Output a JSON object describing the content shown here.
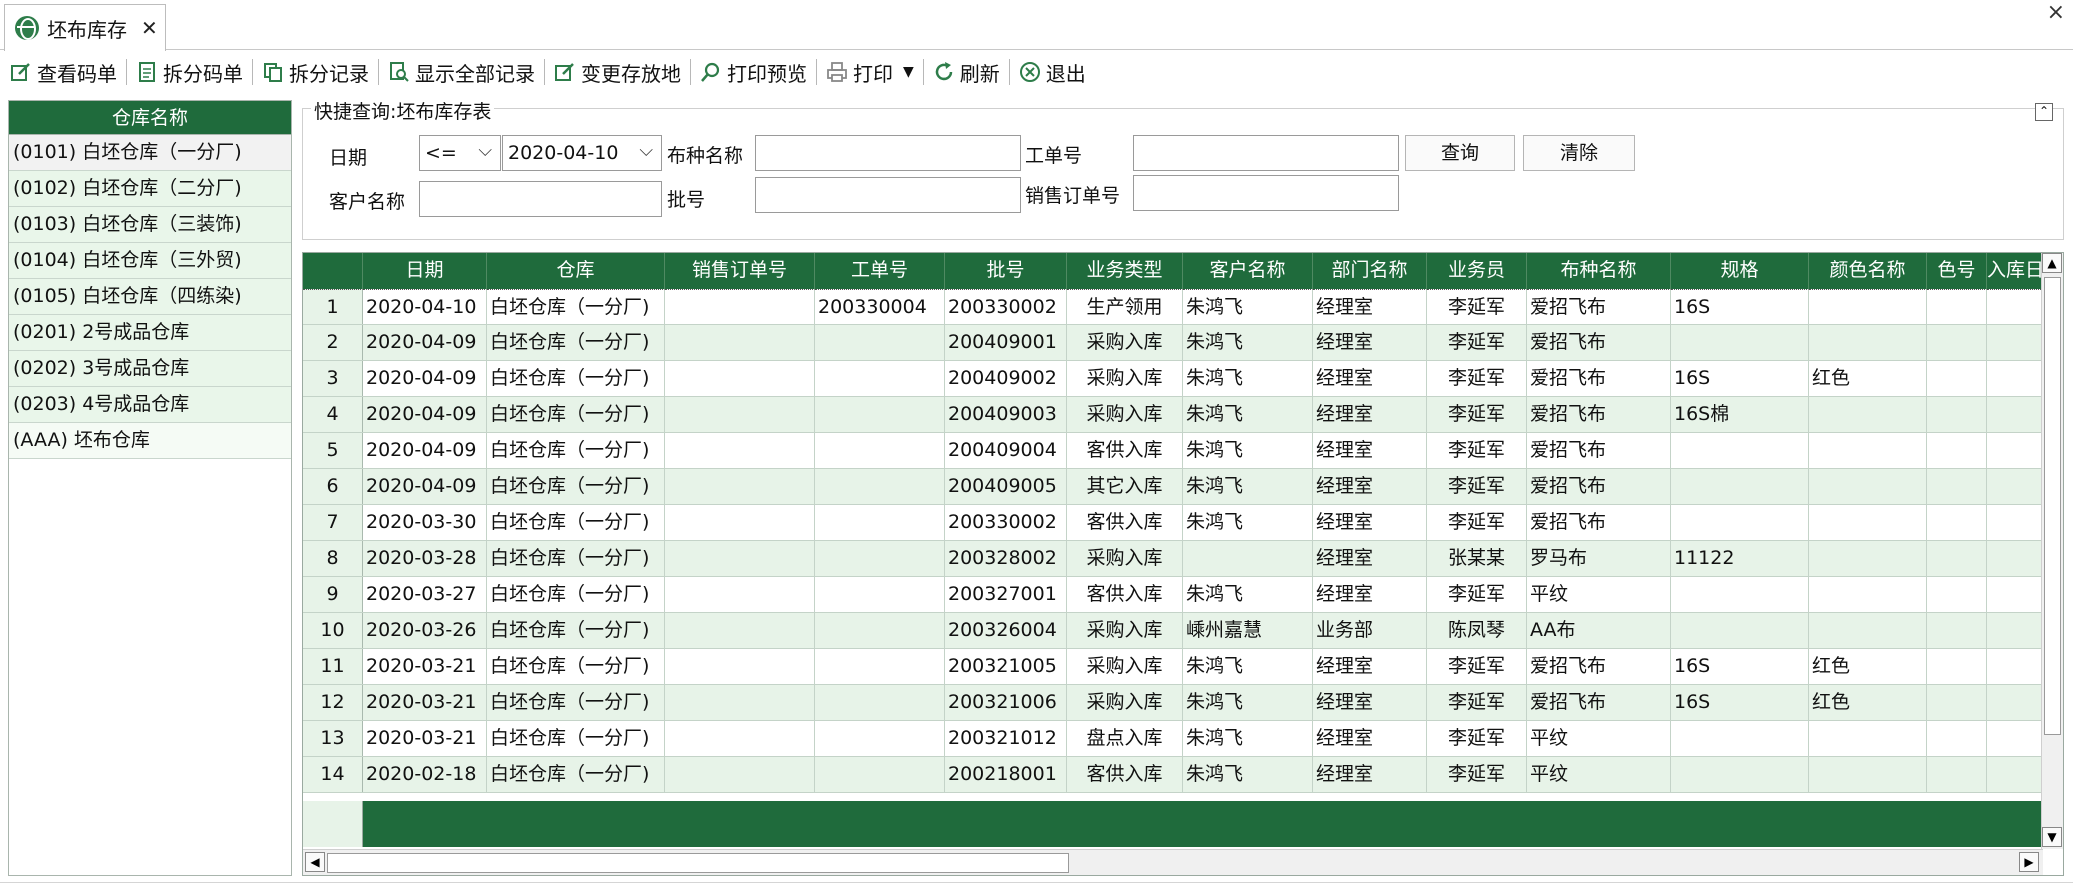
{
  "tab": {
    "title": "坯布库存",
    "close": "✕"
  },
  "window": {
    "close": "×"
  },
  "toolbar": {
    "view_code": "查看码单",
    "split_code": "拆分码单",
    "split_records": "拆分记录",
    "show_all": "显示全部记录",
    "change_location": "变更存放地",
    "print_preview": "打印预览",
    "print": "打印",
    "refresh": "刷新",
    "exit": "退出"
  },
  "warehouses": {
    "header": "仓库名称",
    "items": [
      "(0101) 白坯仓库（一分厂)",
      "(0102) 白坯仓库（二分厂)",
      "(0103) 白坯仓库（三装饰)",
      "(0104) 白坯仓库（三外贸)",
      "(0105) 白坯仓库（四练染)",
      "(0201) 2号成品仓库",
      "(0202) 3号成品仓库",
      "(0203) 4号成品仓库",
      "(AAA) 坯布仓库"
    ]
  },
  "query": {
    "title": "快捷查询:坯布库存表",
    "collapse_icon": "⌃",
    "date_label": "日期",
    "date_op": "<=",
    "date_value": "2020-04-10",
    "fabric_label": "布种名称",
    "fabric_value": "",
    "job_label": "工单号",
    "job_value": "",
    "search_button": "查询",
    "clear_button": "清除",
    "customer_label": "客户名称",
    "customer_value": "",
    "batch_label": "批号",
    "batch_value": "",
    "order_label": "销售订单号",
    "order_value": ""
  },
  "grid": {
    "columns": [
      "",
      "日期",
      "仓库",
      "销售订单号",
      "工单号",
      "批号",
      "业务类型",
      "客户名称",
      "部门名称",
      "业务员",
      "布种名称",
      "规格",
      "颜色名称",
      "色号",
      "入库日"
    ],
    "rows": [
      [
        "1",
        "2020-04-10",
        "白坯仓库（一分厂)",
        "",
        "200330004",
        "200330002",
        "生产领用",
        "朱鸿飞",
        "经理室",
        "李延军",
        "爱招飞布",
        "16S",
        "",
        "",
        ""
      ],
      [
        "2",
        "2020-04-09",
        "白坯仓库（一分厂)",
        "",
        "",
        "200409001",
        "采购入库",
        "朱鸿飞",
        "经理室",
        "李延军",
        "爱招飞布",
        "",
        "",
        "",
        ""
      ],
      [
        "3",
        "2020-04-09",
        "白坯仓库（一分厂)",
        "",
        "",
        "200409002",
        "采购入库",
        "朱鸿飞",
        "经理室",
        "李延军",
        "爱招飞布",
        "16S",
        "红色",
        "",
        ""
      ],
      [
        "4",
        "2020-04-09",
        "白坯仓库（一分厂)",
        "",
        "",
        "200409003",
        "采购入库",
        "朱鸿飞",
        "经理室",
        "李延军",
        "爱招飞布",
        "16S棉",
        "",
        "",
        ""
      ],
      [
        "5",
        "2020-04-09",
        "白坯仓库（一分厂)",
        "",
        "",
        "200409004",
        "客供入库",
        "朱鸿飞",
        "经理室",
        "李延军",
        "爱招飞布",
        "",
        "",
        "",
        ""
      ],
      [
        "6",
        "2020-04-09",
        "白坯仓库（一分厂)",
        "",
        "",
        "200409005",
        "其它入库",
        "朱鸿飞",
        "经理室",
        "李延军",
        "爱招飞布",
        "",
        "",
        "",
        ""
      ],
      [
        "7",
        "2020-03-30",
        "白坯仓库（一分厂)",
        "",
        "",
        "200330002",
        "客供入库",
        "朱鸿飞",
        "经理室",
        "李延军",
        "爱招飞布",
        "",
        "",
        "",
        ""
      ],
      [
        "8",
        "2020-03-28",
        "白坯仓库（一分厂)",
        "",
        "",
        "200328002",
        "采购入库",
        "",
        "经理室",
        "张某某",
        "罗马布",
        "11122",
        "",
        "",
        ""
      ],
      [
        "9",
        "2020-03-27",
        "白坯仓库（一分厂)",
        "",
        "",
        "200327001",
        "客供入库",
        "朱鸿飞",
        "经理室",
        "李延军",
        "平纹",
        "",
        "",
        "",
        ""
      ],
      [
        "10",
        "2020-03-26",
        "白坯仓库（一分厂)",
        "",
        "",
        "200326004",
        "采购入库",
        "嵊州嘉慧",
        "业务部",
        "陈凤琴",
        "AA布",
        "",
        "",
        "",
        ""
      ],
      [
        "11",
        "2020-03-21",
        "白坯仓库（一分厂)",
        "",
        "",
        "200321005",
        "采购入库",
        "朱鸿飞",
        "经理室",
        "李延军",
        "爱招飞布",
        "16S",
        "红色",
        "",
        ""
      ],
      [
        "12",
        "2020-03-21",
        "白坯仓库（一分厂)",
        "",
        "",
        "200321006",
        "采购入库",
        "朱鸿飞",
        "经理室",
        "李延军",
        "爱招飞布",
        "16S",
        "红色",
        "",
        ""
      ],
      [
        "13",
        "2020-03-21",
        "白坯仓库（一分厂)",
        "",
        "",
        "200321012",
        "盘点入库",
        "朱鸿飞",
        "经理室",
        "李延军",
        "平纹",
        "",
        "",
        "",
        ""
      ],
      [
        "14",
        "2020-02-18",
        "白坯仓库（一分厂)",
        "",
        "",
        "200218001",
        "客供入库",
        "朱鸿飞",
        "经理室",
        "李延军",
        "平纹",
        "",
        "",
        "",
        ""
      ]
    ]
  },
  "colors": {
    "header_green": "#1f6b3c",
    "row_alt": "#e7f3e8"
  }
}
